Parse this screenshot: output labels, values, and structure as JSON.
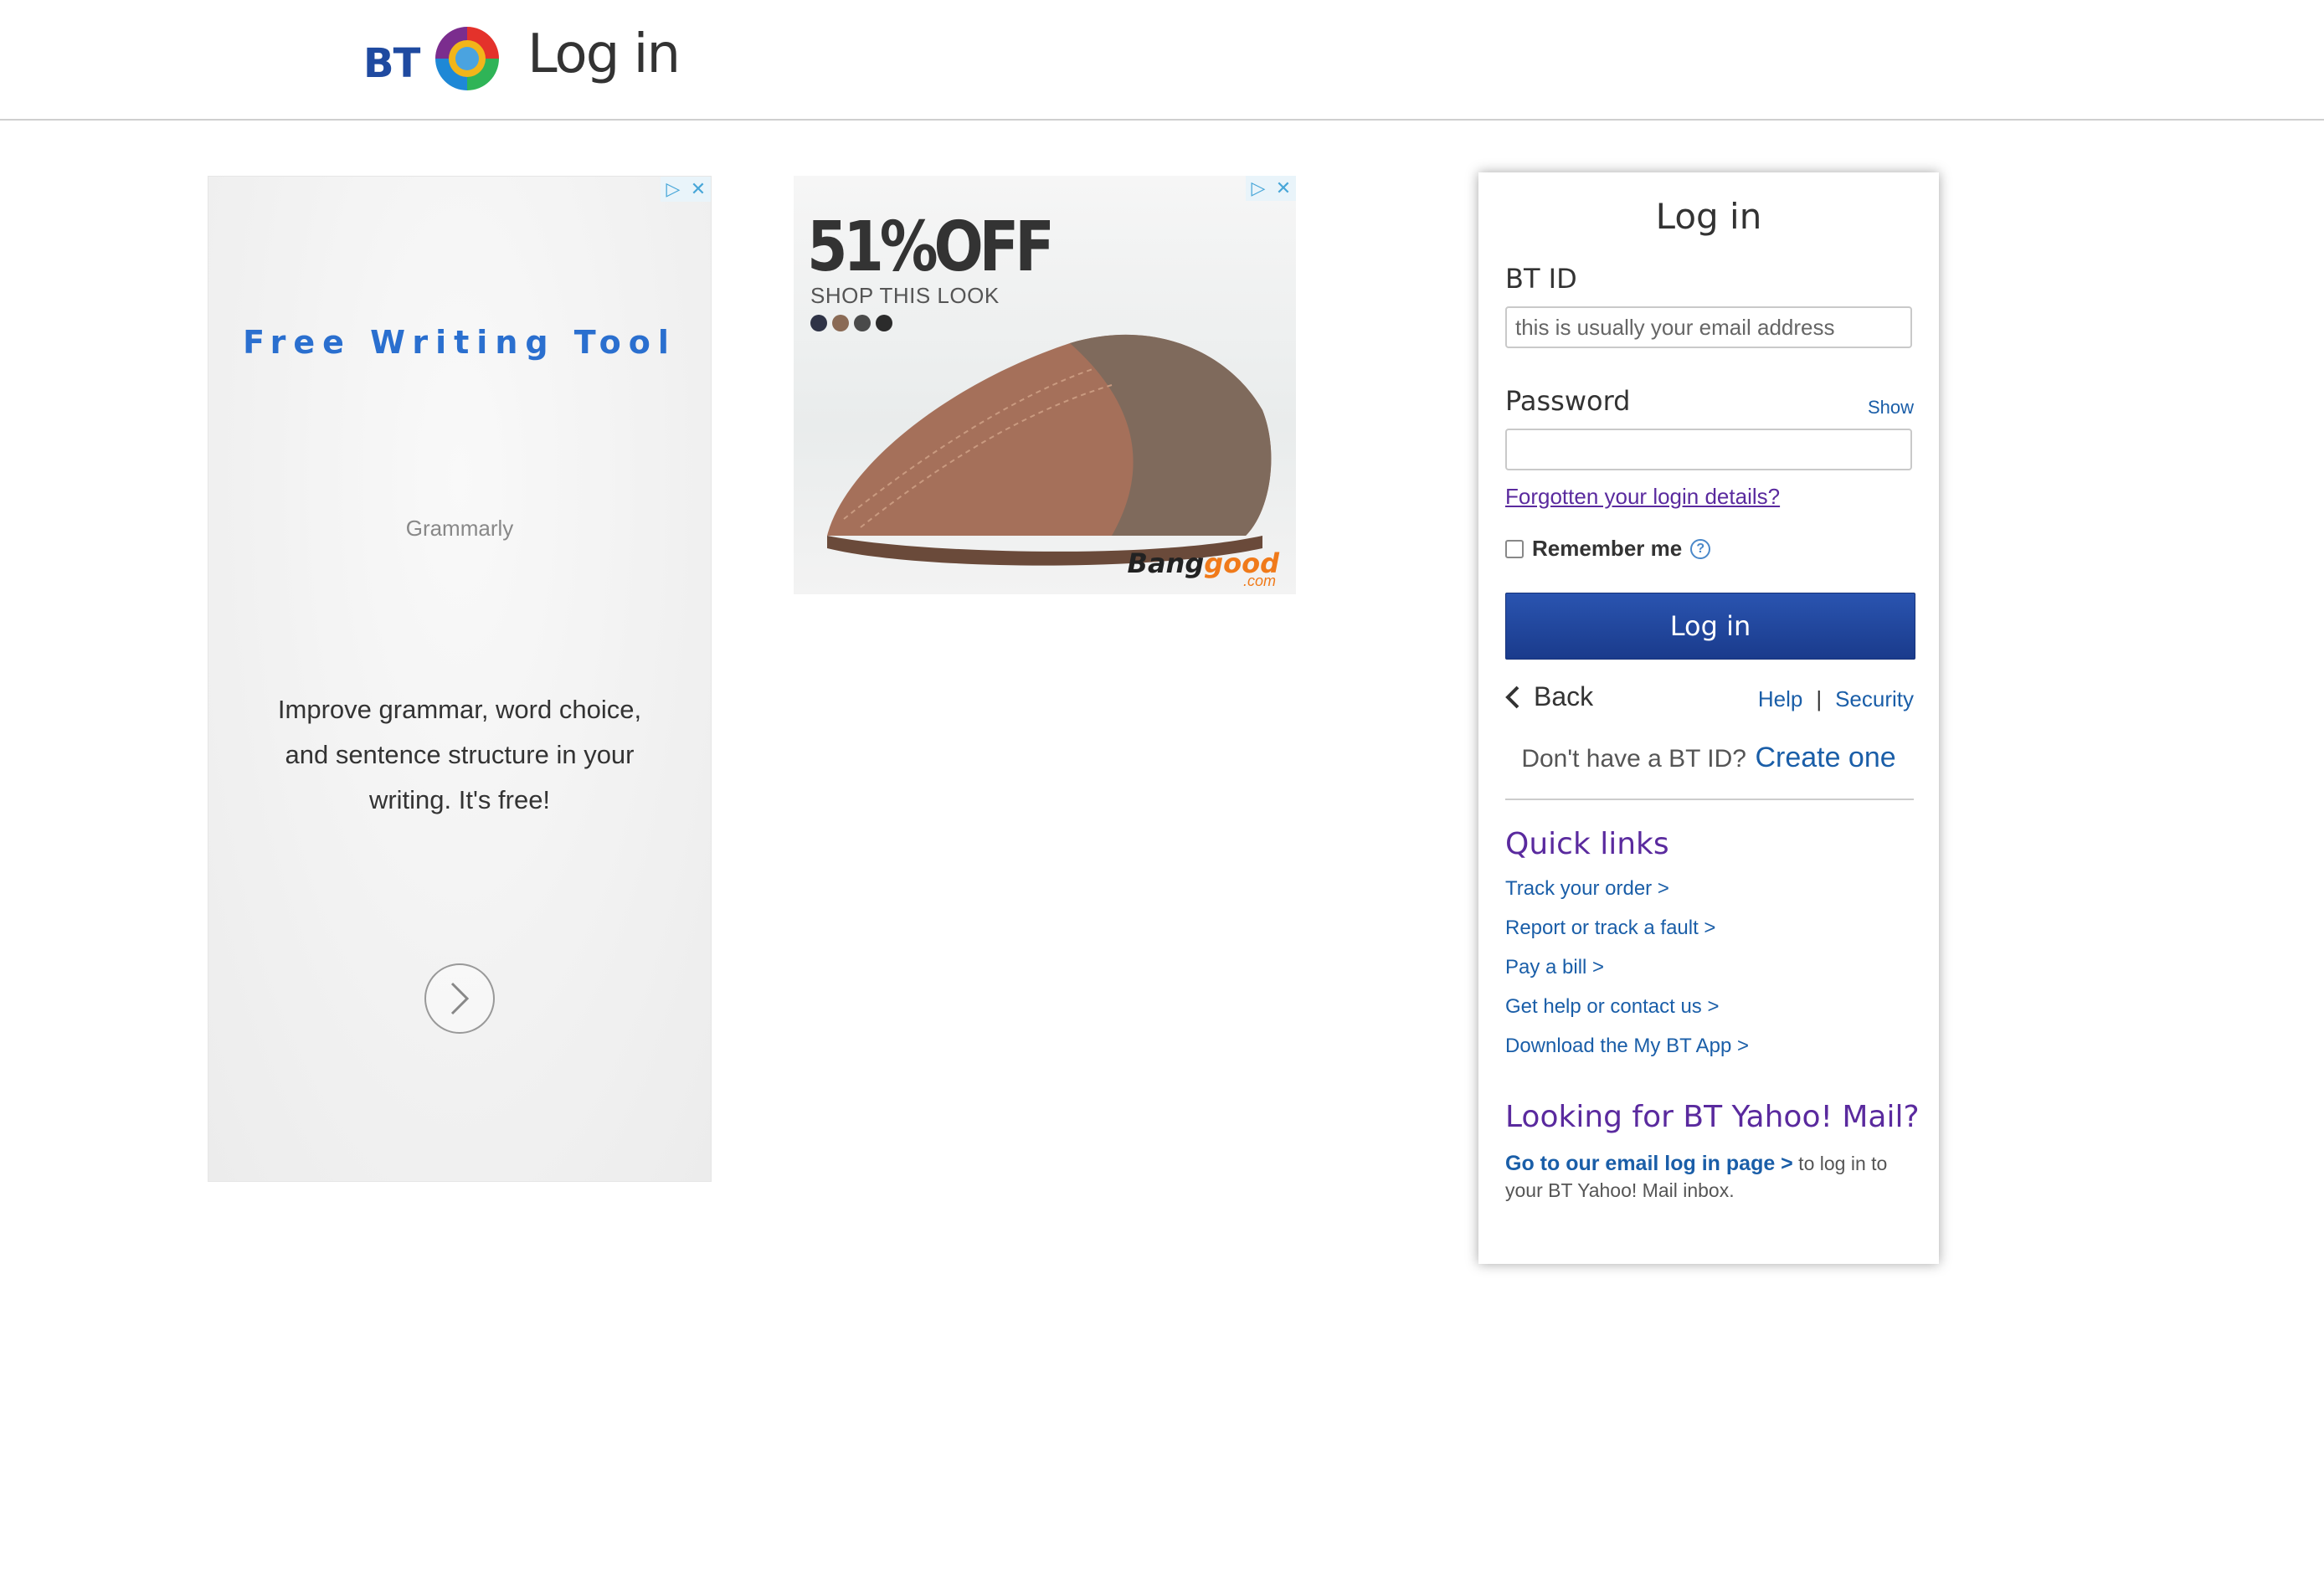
{
  "header": {
    "logo_text": "BT",
    "title": "Log in"
  },
  "ad_left": {
    "adchoices_icon": "adchoices-icon",
    "close_icon": "close-icon",
    "headline": "Free Writing Tool",
    "advertiser": "Grammarly",
    "body": "Improve grammar, word choice, and sentence structure in your writing. It's free!",
    "arrow_icon": "chevron-right-icon"
  },
  "ad_right": {
    "discount": "51%OFF",
    "tagline": "SHOP THIS LOOK",
    "brand_prefix": "Bang",
    "brand_suffix": "good",
    "brand_domain": ".com",
    "swatch_colors": [
      "#2f3346",
      "#8a6a55",
      "#4a4a4a",
      "#2b2b2b"
    ]
  },
  "login": {
    "title": "Log in",
    "btid_label": "BT ID",
    "btid_placeholder": "this is usually your email address",
    "btid_value": "",
    "password_label": "Password",
    "password_value": "",
    "show_label": "Show",
    "forgot_label": "Forgotten your login details?",
    "remember_label": "Remember me",
    "remember_checked": false,
    "submit_label": "Log in",
    "back_label": "Back",
    "help_label": "Help",
    "separator": "|",
    "security_label": "Security",
    "no_id_text": "Don't have a BT ID?",
    "create_label": "Create one"
  },
  "quick_links": {
    "title": "Quick links",
    "items": [
      "Track your order >",
      "Report or track a fault >",
      "Pay a bill >",
      "Get help or contact us >",
      "Download the My BT App >"
    ]
  },
  "yahoo": {
    "title": "Looking for BT Yahoo! Mail?",
    "link_label": "Go to our email log in page >",
    "text": " to log in to your BT Yahoo! Mail inbox."
  },
  "colors": {
    "brand_blue": "#1f4aa0",
    "link_blue": "#1a5ea8",
    "purple": "#5a2a9e",
    "button_top": "#2a54b0",
    "button_bottom": "#1a3b8c",
    "ad_headline": "#2a6fcf"
  }
}
